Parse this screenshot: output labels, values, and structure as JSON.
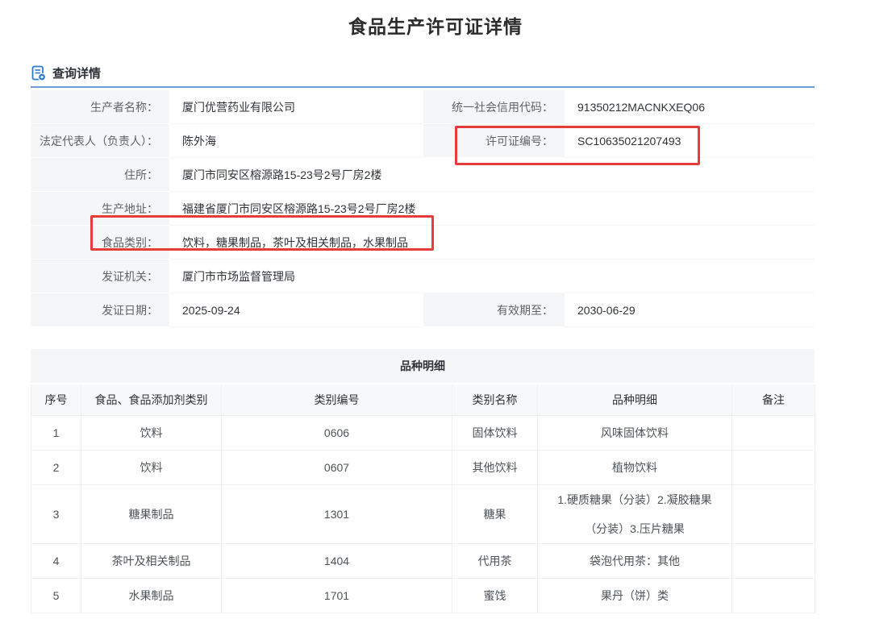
{
  "page": {
    "title": "食品生产许可证详情"
  },
  "section": {
    "header": "查询详情",
    "icon": "document-search-icon"
  },
  "colors": {
    "accent_blue": "#6f9cd4",
    "icon_blue": "#2e7ad1",
    "annotation_red": "#e73c3c"
  },
  "details": {
    "rows": [
      {
        "l1": "生产者名称：",
        "v1": "厦门优营药业有限公司",
        "l2": "统一社会信用代码：",
        "v2": "91350212MACNKXEQ06"
      },
      {
        "l1": "法定代表人（负责人）：",
        "v1": "陈外海",
        "l2": "许可证编号：",
        "v2": "SC10635021207493"
      },
      {
        "l1": "住所：",
        "v1": "厦门市同安区榕源路15-23号2号厂房2楼"
      },
      {
        "l1": "生产地址：",
        "v1": "福建省厦门市同安区榕源路15-23号2号厂房2楼"
      },
      {
        "l1": "食品类别：",
        "v1": "饮料，糖果制品，茶叶及相关制品，水果制品"
      },
      {
        "l1": "发证机关：",
        "v1": "厦门市市场监督管理局"
      },
      {
        "l1": "发证日期：",
        "v1": "2025-09-24",
        "l2": "有效期至：",
        "v2": "2030-06-29"
      }
    ]
  },
  "variety_table": {
    "title": "品种明细",
    "headers": [
      "序号",
      "食品、食品添加剂类别",
      "类别编号",
      "类别名称",
      "品种明细",
      "备注"
    ],
    "rows": [
      [
        "1",
        "饮料",
        "0606",
        "固体饮料",
        "风味固体饮料",
        ""
      ],
      [
        "2",
        "饮料",
        "0607",
        "其他饮料",
        "植物饮料",
        ""
      ],
      [
        "3",
        "糖果制品",
        "1301",
        "糖果",
        "1.硬质糖果（分装）2.凝胶糖果（分装）3.压片糖果",
        ""
      ],
      [
        "4",
        "茶叶及相关制品",
        "1404",
        "代用茶",
        "袋泡代用茶：其他",
        ""
      ],
      [
        "5",
        "水果制品",
        "1701",
        "蜜饯",
        "果丹（饼）类",
        ""
      ]
    ]
  },
  "annotations": {
    "highlights": [
      "license-number",
      "food-category"
    ]
  }
}
